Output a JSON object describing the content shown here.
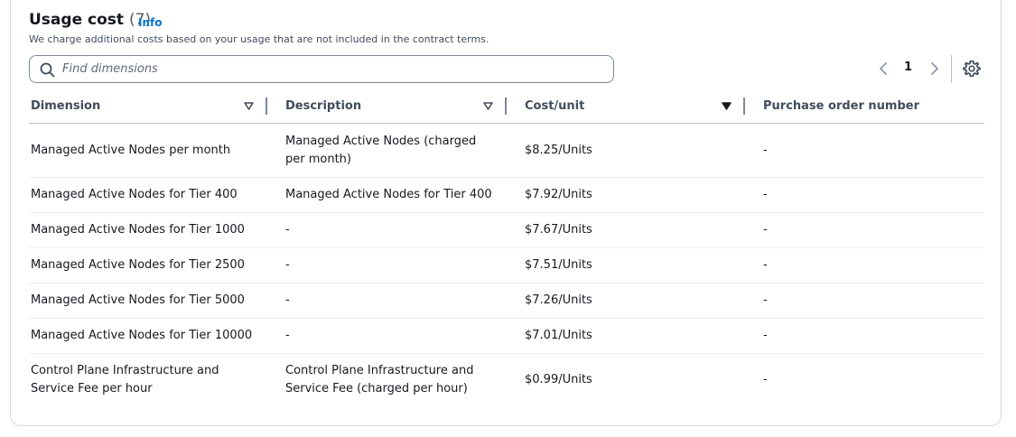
{
  "header": {
    "title": "Usage cost",
    "count": "(7)",
    "info_label": "Info",
    "subtitle": "We charge additional costs based on your usage that are not included in the contract terms."
  },
  "search": {
    "placeholder": "Find dimensions"
  },
  "pagination": {
    "current_page": "1"
  },
  "icons": {
    "search": "search-icon",
    "prev": "chevron-left-icon",
    "next": "chevron-right-icon",
    "settings": "gear-icon",
    "sort": "caret-down-icon"
  },
  "table": {
    "columns": [
      "Dimension",
      "Description",
      "Cost/unit",
      "Purchase order number"
    ],
    "rows": [
      {
        "dimension": "Managed Active Nodes per month",
        "description": "Managed Active Nodes (charged per month)",
        "cost": "$8.25/Units",
        "po": "-"
      },
      {
        "dimension": "Managed Active Nodes for Tier 400",
        "description": "Managed Active Nodes for Tier 400",
        "cost": "$7.92/Units",
        "po": "-"
      },
      {
        "dimension": "Managed Active Nodes for Tier 1000",
        "description": "-",
        "cost": "$7.67/Units",
        "po": "-"
      },
      {
        "dimension": "Managed Active Nodes for Tier 2500",
        "description": "-",
        "cost": "$7.51/Units",
        "po": "-"
      },
      {
        "dimension": "Managed Active Nodes for Tier 5000",
        "description": "-",
        "cost": "$7.26/Units",
        "po": "-"
      },
      {
        "dimension": "Managed Active Nodes for Tier 10000",
        "description": "-",
        "cost": "$7.01/Units",
        "po": "-"
      },
      {
        "dimension": "Control Plane Infrastructure and Service Fee per hour",
        "description": "Control Plane Infrastructure and Service Fee (charged per hour)",
        "cost": "$0.99/Units",
        "po": "-"
      }
    ]
  },
  "colors": {
    "link": "#0972d3",
    "text": "#16191f",
    "muted": "#414d5c",
    "border": "#d5dbdb"
  }
}
